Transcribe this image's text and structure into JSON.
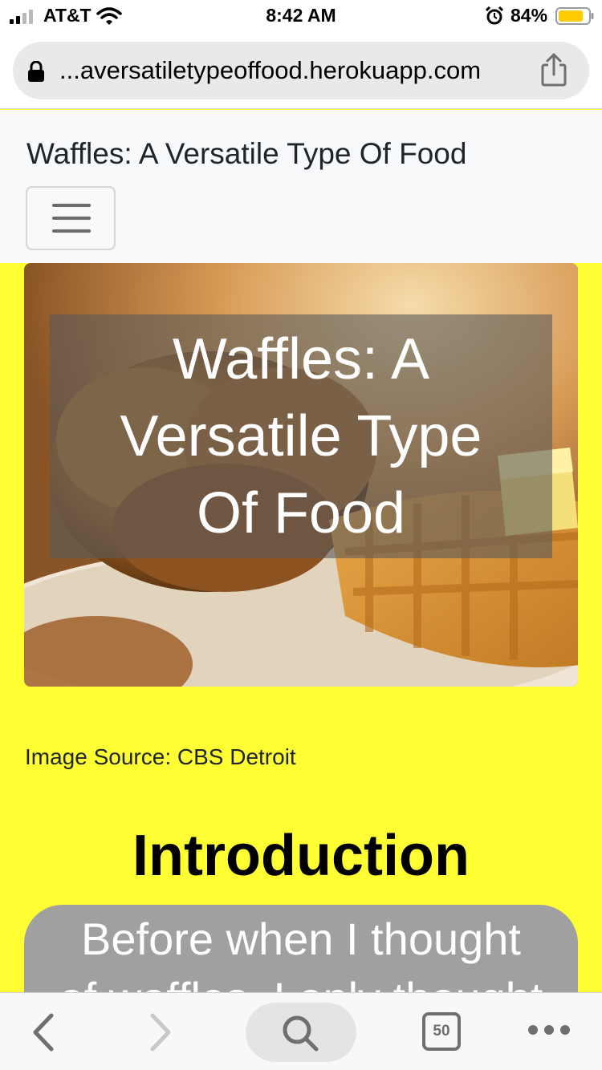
{
  "status_bar": {
    "carrier": "AT&T",
    "time": "8:42 AM",
    "battery_percent": "84%",
    "battery_level": 0.84,
    "icons": [
      "signal-icon",
      "wifi-icon",
      "alarm-icon",
      "battery-icon"
    ]
  },
  "browser": {
    "url": "...aversatiletypeoffood.herokuapp.com",
    "tab_count": "50"
  },
  "navbar": {
    "brand": "Waffles: A Versatile Type Of Food"
  },
  "hero": {
    "caption_lines": [
      "Waffles: A",
      "Versatile Type",
      "Of Food"
    ]
  },
  "content": {
    "image_source": "Image Source: CBS Detroit",
    "heading": "Introduction",
    "intro_lines": [
      "Before when I thought",
      "of waffles, I only thought"
    ]
  },
  "colors": {
    "page_background": "#ffff33",
    "navbar_background": "#f8f9fa",
    "caption_overlay": "rgba(90,90,90,0.6)",
    "intro_box": "#a0a0a0",
    "battery_fill": "#ffcc00"
  }
}
